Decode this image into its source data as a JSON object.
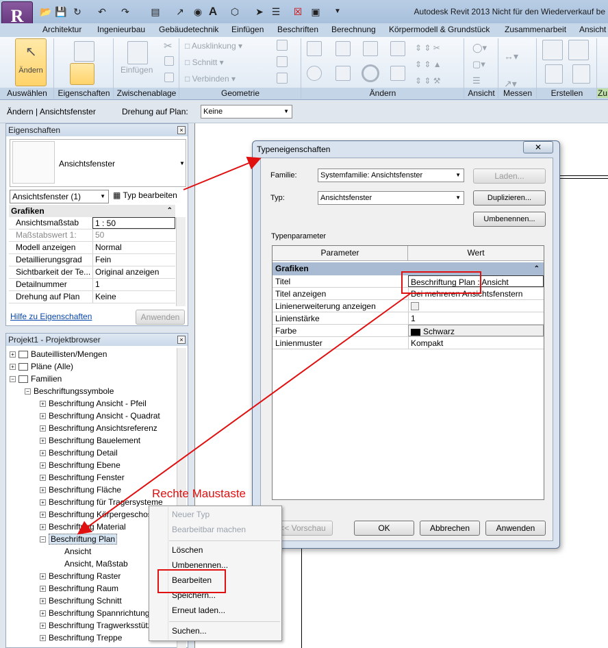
{
  "app": {
    "title": "Autodesk Revit 2013 Nicht für den Wiederverkauf be",
    "logo_letter": "R"
  },
  "quick_access": [
    "folder-open-icon",
    "save-icon",
    "sync-icon",
    "undo-icon",
    "redo-icon",
    "print-icon",
    "measure-icon",
    "tag-icon",
    "text-icon",
    "3d-view-icon",
    "section-icon",
    "thin-lines-icon",
    "close-hidden-icon",
    "switch-windows-icon",
    "dropdown-icon"
  ],
  "ribbon": {
    "tabs": [
      "Architektur",
      "Ingenieurbau",
      "Gebäudetechnik",
      "Einfügen",
      "Beschriften",
      "Berechnung",
      "Körpermodell & Grundstück",
      "Zusammenarbeit",
      "Ansicht"
    ],
    "modify_label": "Ändern",
    "paste_label": "Einfügen",
    "geometry_items": [
      "Ausklinkung",
      "Schnitt",
      "Verbinden"
    ],
    "groups": [
      "Auswählen",
      "Eigenschaften",
      "Zwischenablage",
      "Geometrie",
      "Ändern",
      "Ansicht",
      "Messen",
      "Erstellen",
      "Zu"
    ]
  },
  "options_bar": {
    "context": "Ändern | Ansichtsfenster",
    "rotate_label": "Drehung auf Plan:",
    "rotate_value": "Keine"
  },
  "properties": {
    "title": "Eigenschaften",
    "type_name": "Ansichtsfenster",
    "filter_value": "Ansichtsfenster (1)",
    "edit_type_label": "Typ bearbeiten",
    "group": "Grafiken",
    "rows": [
      {
        "name": "Ansichtsmaßstab",
        "value": "1 : 50"
      },
      {
        "name": "Maßstabswert 1:",
        "value": "50"
      },
      {
        "name": "Modell anzeigen",
        "value": "Normal"
      },
      {
        "name": "Detaillierungsgrad",
        "value": "Fein"
      },
      {
        "name": "Sichtbarkeit der Te...",
        "value": "Original anzeigen"
      },
      {
        "name": "Detailnummer",
        "value": "1"
      },
      {
        "name": "Drehung auf Plan",
        "value": "Keine"
      }
    ],
    "help_link": "Hilfe zu Eigenschaften",
    "apply_label": "Anwenden"
  },
  "browser": {
    "title": "Projekt1 - Projektbrowser",
    "items": [
      {
        "label": "Bauteillisten/Mengen",
        "level": 0,
        "toggle": "+",
        "icon": "schedule-icon"
      },
      {
        "label": "Pläne (Alle)",
        "level": 0,
        "toggle": "+",
        "icon": "sheet-icon"
      },
      {
        "label": "Familien",
        "level": 0,
        "toggle": "-",
        "icon": "family-icon"
      },
      {
        "label": "Beschriftungssymbole",
        "level": 1,
        "toggle": "-"
      },
      {
        "label": "Beschriftung Ansicht - Pfeil",
        "level": 2,
        "toggle": "+"
      },
      {
        "label": "Beschriftung Ansicht - Quadrat",
        "level": 2,
        "toggle": "+"
      },
      {
        "label": "Beschriftung Ansichtsreferenz",
        "level": 2,
        "toggle": "+"
      },
      {
        "label": "Beschriftung Bauelement",
        "level": 2,
        "toggle": "+"
      },
      {
        "label": "Beschriftung Detail",
        "level": 2,
        "toggle": "+"
      },
      {
        "label": "Beschriftung Ebene",
        "level": 2,
        "toggle": "+"
      },
      {
        "label": "Beschriftung Fenster",
        "level": 2,
        "toggle": "+"
      },
      {
        "label": "Beschriftung Fläche",
        "level": 2,
        "toggle": "+"
      },
      {
        "label": "Beschriftung für Tragersysteme",
        "level": 2,
        "toggle": "+"
      },
      {
        "label": "Beschriftung Körpergeschoss",
        "level": 2,
        "toggle": "+"
      },
      {
        "label": "Beschriftung Material",
        "level": 2,
        "toggle": "+"
      },
      {
        "label": "Beschriftung Plan",
        "level": 2,
        "toggle": "-",
        "selected": true
      },
      {
        "label": "Ansicht",
        "level": 3
      },
      {
        "label": "Ansicht, Maßstab",
        "level": 3
      },
      {
        "label": "Beschriftung Raster",
        "level": 2,
        "toggle": "+"
      },
      {
        "label": "Beschriftung Raum",
        "level": 2,
        "toggle": "+"
      },
      {
        "label": "Beschriftung Schnitt",
        "level": 2,
        "toggle": "+"
      },
      {
        "label": "Beschriftung Spannrichtung",
        "level": 2,
        "toggle": "+"
      },
      {
        "label": "Beschriftung Tragwerksstütze",
        "level": 2,
        "toggle": "+"
      },
      {
        "label": "Beschriftung Treppe",
        "level": 2,
        "toggle": "+"
      }
    ]
  },
  "context_menu": {
    "items": [
      {
        "label": "Neuer Typ",
        "enabled": false
      },
      {
        "label": "Bearbeitbar machen",
        "enabled": false
      },
      {
        "label": "Löschen",
        "enabled": true
      },
      {
        "label": "Umbenennen...",
        "enabled": true
      },
      {
        "label": "Bearbeiten",
        "enabled": true
      },
      {
        "label": "Speichern...",
        "enabled": true
      },
      {
        "label": "Erneut laden...",
        "enabled": true
      },
      {
        "label": "Suchen...",
        "enabled": true
      }
    ]
  },
  "annotation": {
    "label": "Rechte Maustaste",
    "color": "#e01010"
  },
  "dialog": {
    "title": "Typeneigenschaften",
    "family_label": "Familie:",
    "family_value": "Systemfamilie: Ansichtsfenster",
    "type_label": "Typ:",
    "type_value": "Ansichtsfenster",
    "load_label": "Laden...",
    "duplicate_label": "Duplizieren...",
    "rename_label": "Umbenennen...",
    "params_label": "Typenparameter",
    "col_param": "Parameter",
    "col_value": "Wert",
    "group": "Grafiken",
    "rows": [
      {
        "name": "Titel",
        "value": "Beschriftung Plan : Ansicht"
      },
      {
        "name": "Titel anzeigen",
        "value": "Bei mehreren Ansichtsfenstern"
      },
      {
        "name": "Linienerweiterung anzeigen",
        "value": ""
      },
      {
        "name": "Linienstärke",
        "value": "1"
      },
      {
        "name": "Farbe",
        "value": "Schwarz"
      },
      {
        "name": "Linienmuster",
        "value": "Kompakt"
      }
    ],
    "preview_label": "<< Vorschau",
    "ok_label": "OK",
    "cancel_label": "Abbrechen",
    "apply_label": "Anwenden"
  }
}
